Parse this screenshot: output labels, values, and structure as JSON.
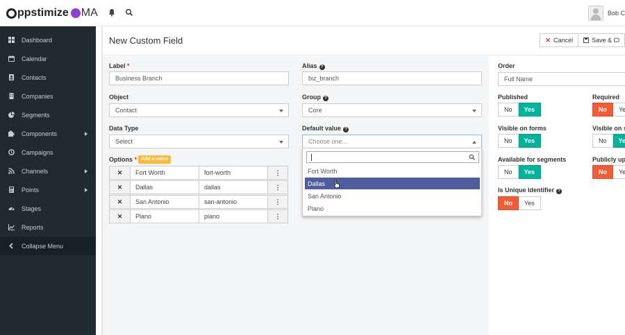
{
  "app": {
    "logo_main": "ppstimize",
    "logo_suffix": "MA",
    "user_name": "Bob C"
  },
  "sidebar": {
    "items": [
      {
        "label": "Dashboard",
        "icon": "dashboard-icon",
        "has_submenu": false
      },
      {
        "label": "Calendar",
        "icon": "calendar-icon",
        "has_submenu": false
      },
      {
        "label": "Contacts",
        "icon": "contacts-icon",
        "has_submenu": false
      },
      {
        "label": "Companies",
        "icon": "building-icon",
        "has_submenu": false
      },
      {
        "label": "Segments",
        "icon": "pie-chart-icon",
        "has_submenu": false
      },
      {
        "label": "Components",
        "icon": "puzzle-icon",
        "has_submenu": true
      },
      {
        "label": "Campaigns",
        "icon": "clock-icon",
        "has_submenu": false
      },
      {
        "label": "Channels",
        "icon": "rss-icon",
        "has_submenu": true
      },
      {
        "label": "Points",
        "icon": "calculator-icon",
        "has_submenu": true
      },
      {
        "label": "Stages",
        "icon": "tachometer-icon",
        "has_submenu": false
      },
      {
        "label": "Reports",
        "icon": "line-chart-icon",
        "has_submenu": false
      }
    ],
    "collapse_label": "Collapse Menu"
  },
  "header": {
    "title": "New Custom Field",
    "cancel_label": "Cancel",
    "save_label": "Save & Cl"
  },
  "form": {
    "label": {
      "title": "Label",
      "value": "Business Branch"
    },
    "alias": {
      "title": "Alias",
      "value": "biz_branch"
    },
    "object": {
      "title": "Object",
      "value": "Contact"
    },
    "group": {
      "title": "Group",
      "value": "Core"
    },
    "data_type": {
      "title": "Data Type",
      "value": "Select"
    },
    "default_value": {
      "title": "Default value",
      "placeholder": "Choose one..."
    },
    "options": {
      "title": "Options",
      "add_label": "Add a value",
      "rows": [
        {
          "label": "Fort Worth",
          "value": "fort-worth"
        },
        {
          "label": "Dallas",
          "value": "dallas"
        },
        {
          "label": "San Antonio",
          "value": "san-antonio"
        },
        {
          "label": "Plano",
          "value": "plano"
        }
      ]
    },
    "dropdown": {
      "items": [
        "Fort Worth",
        "Dallas",
        "San Antonio",
        "Plano"
      ],
      "highlighted": "Dallas"
    }
  },
  "right_panel": {
    "order": {
      "title": "Order",
      "value": "Full Name"
    },
    "published": {
      "title": "Published",
      "no": "No",
      "yes": "Yes",
      "selected": "yes"
    },
    "required": {
      "title": "Required",
      "no": "No",
      "yes": "Yes",
      "selected": "no"
    },
    "visible_on_forms": {
      "title": "Visible on forms",
      "no": "No",
      "yes": "Yes",
      "selected": "yes"
    },
    "visible_on_sl": {
      "title": "Visible on sl",
      "no": "No",
      "yes": "Yes",
      "selected": "yes"
    },
    "available_for_segments": {
      "title": "Available for segments",
      "no": "No",
      "yes": "Yes",
      "selected": "yes"
    },
    "publicly_upd": {
      "title": "Publicly upd",
      "no": "No",
      "yes": "Yes",
      "selected": "no"
    },
    "is_unique_identifier": {
      "title": "Is Unique Identifier",
      "no": "No",
      "yes": "Yes",
      "selected": "no"
    }
  },
  "colors": {
    "sidebar_bg": "#1f2a33",
    "green": "#00b49c",
    "red": "#f05c36",
    "highlight": "#4e5d9d",
    "add_badge": "#fdb933",
    "logo_purple": "#8e3ed6"
  }
}
